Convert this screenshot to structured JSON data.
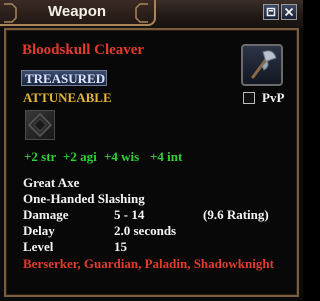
{
  "window": {
    "title": "Weapon"
  },
  "item": {
    "name": "Bloodskull Cleaver",
    "tag": "TREASURED",
    "attuneable": "ATTUNEABLE",
    "pvp_label": "PvP",
    "stats": [
      "+2 str",
      "+2 agi",
      "+4 wis",
      "+4 int"
    ],
    "weapon_type": "Great Axe",
    "damage_type": "One-Handed Slashing",
    "details": {
      "damage_label": "Damage",
      "damage_value": "5 - 14",
      "rating": "(9.6 Rating)",
      "delay_label": "Delay",
      "delay_value": "2.0 seconds",
      "level_label": "Level",
      "level_value": "15"
    },
    "classes": "Berserker, Guardian, Paladin, Shadowknight"
  },
  "icons": {
    "item": "axe-icon",
    "window_button_1": "restore-icon",
    "window_button_2": "close-icon"
  },
  "colors": {
    "item_name": "#e23b2e",
    "treasured_badge": "#3a4a6e",
    "attuneable": "#e2b63a",
    "stats": "#2fd234",
    "classes": "#e23b2e",
    "frame_border": "#7a5e3c"
  }
}
